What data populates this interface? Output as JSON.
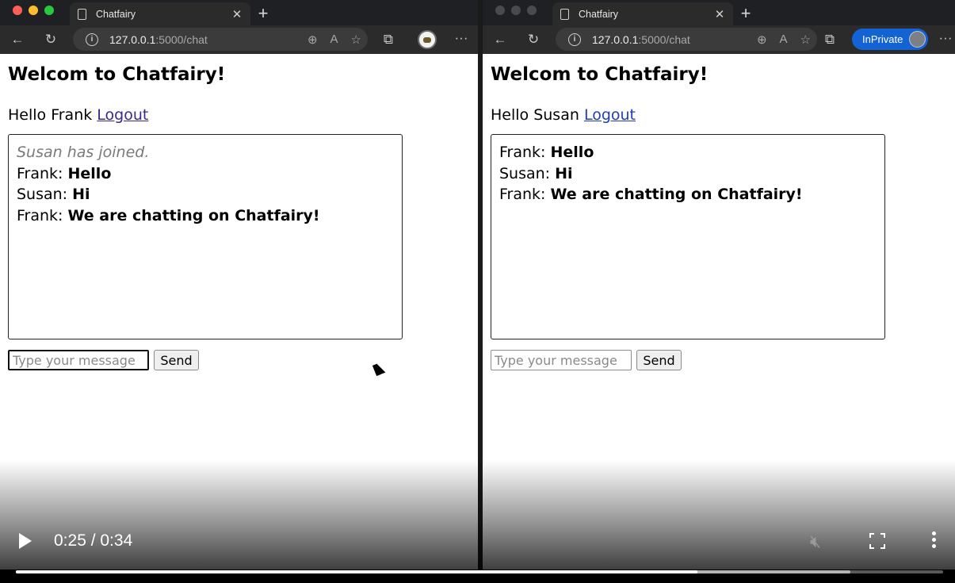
{
  "left": {
    "tab": {
      "title": "Chatfairy"
    },
    "address": {
      "host": "127.0.0.1",
      "path": ":5000/chat"
    },
    "page": {
      "heading": "Welcom to Chatfairy!",
      "greeting": "Hello Frank",
      "logout": "Logout",
      "system_message": "Susan has joined.",
      "messages": [
        {
          "sender": "Frank:",
          "text": "Hello"
        },
        {
          "sender": "Susan:",
          "text": "Hi"
        },
        {
          "sender": "Frank:",
          "text": "We are chatting on Chatfairy!"
        }
      ],
      "input_placeholder": "Type your message",
      "send": "Send"
    }
  },
  "right": {
    "tab": {
      "title": "Chatfairy"
    },
    "address": {
      "host": "127.0.0.1",
      "path": ":5000/chat"
    },
    "inprivate": "InPrivate",
    "page": {
      "heading": "Welcom to Chatfairy!",
      "greeting": "Hello Susan",
      "logout": "Logout",
      "messages": [
        {
          "sender": "Frank:",
          "text": "Hello"
        },
        {
          "sender": "Susan:",
          "text": "Hi"
        },
        {
          "sender": "Frank:",
          "text": "We are chatting on Chatfairy!"
        }
      ],
      "input_placeholder": "Type your message",
      "send": "Send"
    }
  },
  "video": {
    "time": "0:25 / 0:34",
    "played_fraction": 0.735,
    "buffered_fraction": 0.9
  },
  "colors": {
    "traffic_red": "#ff5f57",
    "traffic_yellow": "#febc2e",
    "traffic_green": "#28c840",
    "inprivate_blue": "#1463d4"
  }
}
